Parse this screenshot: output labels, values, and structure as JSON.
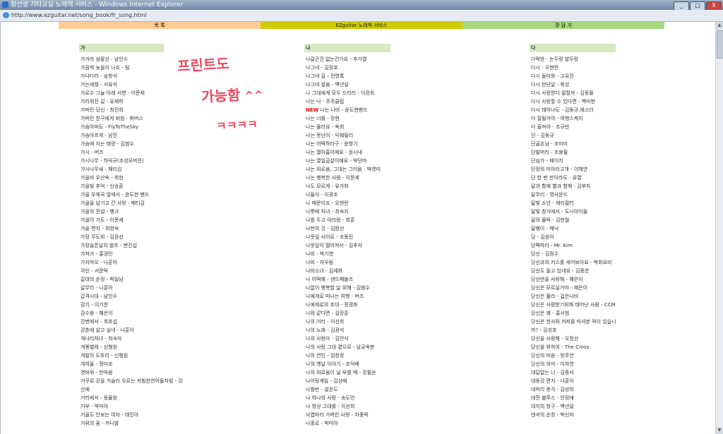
{
  "window": {
    "title": "황선생 기타교실 노래책 서비스 - Windows Internet Explorer",
    "url": "http://www.ezguitar.net/song_book/fr_song.html",
    "buttons": [
      "_",
      "□",
      "X"
    ]
  },
  "nav": {
    "items": [
      "목 록",
      "EZguitar 노래책 서비스",
      "장 담 기"
    ]
  },
  "columns": [
    {
      "header": "가",
      "items": [
        "가거라 삼팔선 - 남인수",
        "가끔씩 늦을이 나죠 - 팀",
        "가나다라 - 송창식",
        "가는세월 - 서유석",
        "가로수 그늘 아래 서면 - 이문세",
        "가리워진 길 - 유재하",
        "가버린 당신 - 최진희",
        "가버린 친구에게 바침 - 휘버스",
        "가슴아파도 - FlyToTheSky",
        "가슴아프게 - 남진",
        "가슴에 지는 태양 - 김범수",
        "가시 - 버즈",
        "가시나무 - 하덕규(조성모버전)",
        "가시나무새 - 패티김",
        "가을비 우산속 - 최헌",
        "가을빛 추억 - 신승훈",
        "가을 우체국 앞에서 - 윤도현 밴드",
        "가을을 남기고 간 사랑 - 패티김",
        "가을의 전설 - 뱅크",
        "가을이 가도 - 이문세",
        "가을 편지 - 최양숙",
        "가장 무도회 - 김완선",
        "가장슬픈날의 왈츠 - 변진섭",
        "가져가 - 홍경민",
        "가지마오 - 나훈아",
        "각인 - 서문탁",
        "갈대의 순정 - 박일남",
        "갈무리 - 나훈아",
        "갑격시대 - 남인수",
        "감기 - 이기찬",
        "감수왕 - 혜은이",
        "강변에서 - 최호섭",
        "강촌에 살고 싶네 - 나훈아",
        "개나리처녀 - 최숙자",
        "개똥벌레 - 신형원",
        "개발의 도토리 - 신형원",
        "개여울 - 정미조",
        "갯바위 - 한마음",
        "거꾸로 강을 거슬러 오르는 저힘찬연어들처럼 - 강산에",
        "거리에서 - 동물원",
        "거부 - 박미아",
        "거울도 안보는 여자 - 태진아",
        "거위의 꿈 - 카니발"
      ]
    },
    {
      "header": "나",
      "items": [
        "나갈곤건 없는건가요 - 추가열",
        "나그네 - 김정호",
        "나그네 길 - 전영록",
        "나그네 설움 - 백년설",
        "나 그대에게 모두 드리리 - 이장희",
        "나는 나 - 주주클럽",
        "나는 나비 - 윤도현밴드",
        "나는 너를 - 장현",
        "나는 몰라요 - 옥희",
        "나는 못난이 - 딕훼밀리",
        "나는 어떡하라구 - 윤항기",
        "나는 열아홉이예요 - 윤시내",
        "나는 열일곱살이예요 - 박단마",
        "나는 외로움, 그대는 그리움 - 박영미",
        "나는 행복한 사람 - 이문세",
        "나도 모르게 - 유가화",
        "나들이 - 이광조",
        "나 때문이죠 - 오현란",
        "나룻배 처녀 - 최숙자",
        "나를 두고 아리랑 - 최훈",
        "나만의 것 - 김완선",
        "나뭇잎 사이로 - 조동진",
        "나뭇잎이 떨어져서 - 김추자",
        "나비 - 박기영",
        "나비 - 자우림",
        "나비소녀 - 김세화",
        "나 어떡해 - 샌드페블즈",
        "나없이 행복할 날 위해 - 김범수",
        "나에게로 떠나는 여행 - 버즈",
        "나에게로의 초대 - 정경화",
        "나와 같다면 - 김장훈",
        "나의 거리 - 이선희",
        "나의 노래 - 김광석",
        "나의 사랑아 - 김민식",
        "나의 사랑 그대 곁으로 - 남궁옥분",
        "나의 연인 - 임창정",
        "나의 옛날 이야기 - 조덕배",
        "나의 외로움이 널 부를 때 - 장필순",
        "나이팅게일 - 김상배",
        "나침반 - 설운도",
        "나 하나의 사랑 - 송도민",
        "나 항상 그대를 - 이선희",
        "낙엽따라 가버린 사랑 - 차중락",
        "나홀로 - 박미아"
      ]
    },
    {
      "header": "다",
      "items": [
        "다락방 - 논두렁 밭두렁",
        "다시 - 오현란",
        "다시 돌아와 - 고유진",
        "다시 만난날 - 휘성",
        "다시 사랑한다 말할까 - 김동률",
        "다시 사랑할 수 있다면 - 백미현",
        "다시 태어나도 - 김동규,에스더",
        "다 잘될거야 - 여행스케치",
        "다 줄꺼야 - 조규만",
        "단 - 김동규",
        "단골손님 - 조미미",
        "단발머리 - 조용필",
        "단심가 - 페이지",
        "단장의 미아리고개 - 이해연",
        "단 한 번 만이라도 - 유열",
        "달과 함께 별과 함께 - 김부자",
        "달무리 - 영사운드",
        "달빛 소년 - 체리필터",
        "달빛 창가에서 - 도시아이들",
        "달의 몰락 - 김현철",
        "달팽이 - 패닉",
        "당 - 김윤아",
        "당떽하라 - Mr. Kim",
        "당신 - 김정수",
        "당신과의 키스를 세어보아요 - 박화요비",
        "당신도 울고 있네요 - 김종찬",
        "당신만을 사랑해 - 혜은이",
        "당신은 모르실거야 - 혜은이",
        "당신은 몰라 - 겁은나비",
        "당신은 사랑받기위해 태어난 사람 - CCM",
        "당신은 왜 - 홍서범",
        "당신은 천사와 커피를 마셔본 적이 있습니까? - 김성호",
        "당신을 사랑해 - 오정선",
        "당신을 위하여 - The Cross",
        "당신의 마음 - 방주연",
        "당신의 의미 - 이자연",
        "대답없는 너 - 김종서",
        "대동강 편지 - 나훈아",
        "대머리 총각 - 김상희",
        "대전 블루스 - 안정애",
        "대지의 항구 - 백년설",
        "댄서의 순정 - 박신자"
      ]
    }
  ],
  "new_badge": "NEW",
  "annotation": {
    "line1": "프린트도",
    "line2": "가능함",
    "smile": "^^",
    "line3": "ㅋㅋㅋㅋ"
  }
}
